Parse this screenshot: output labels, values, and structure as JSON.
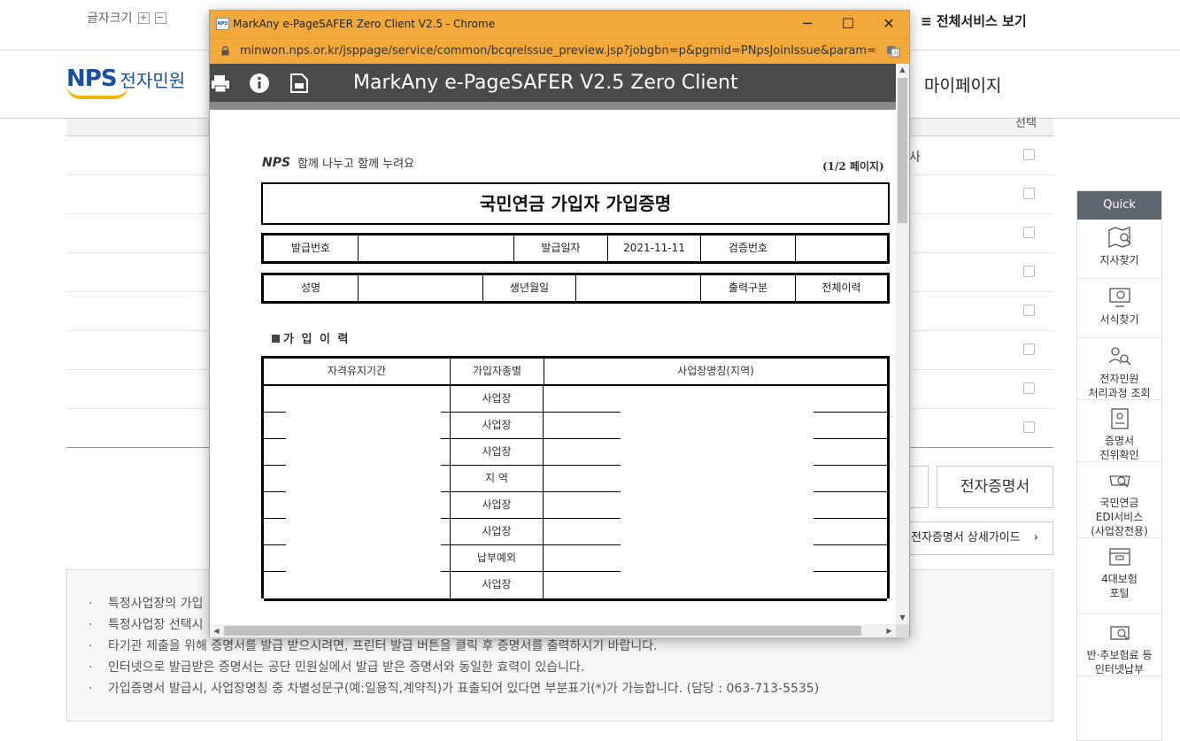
{
  "site": {
    "font_size_label": "글자크기",
    "font_plus": "+",
    "font_minus": "−",
    "all_services": "≡ 전체서비스 보기",
    "logo_text": "NPS",
    "logo_sub": "전자민원",
    "mypage": "마이페이지",
    "ecert_button": "전자증명서",
    "ecert_guide": "전자증명서 상세가이드",
    "guide_arrow": "›",
    "notes": [
      "특정사업장의 가입",
      "특정사업장 선택시",
      "타기관 제출을 위해 증명서를 발급 받으시려면, 프린터 발급 버튼을 클릭 후 증명서를 출력하시기 바랍니다.",
      "인터넷으로 발급받은 증명서는 공단 민원실에서 발급 받은 증명서와 동일한 효력이 있습니다.",
      "가입증명서 발급시, 사업장명칭 중 차별성문구(예:일용직,계약직)가 표출되어 있다면 부분표기(*)가 가능합니다. (담당 : 063-713-5535)"
    ],
    "bg_row_fragment": "사",
    "bg_header_fragment": "선택"
  },
  "quick": {
    "title": "Quick",
    "items": [
      {
        "label": "지사찾기",
        "icon": "map-search-icon"
      },
      {
        "label": "서식찾기",
        "icon": "monitor-search-icon"
      },
      {
        "label": "전자민원\n처리과정 조회",
        "icon": "people-search-icon"
      },
      {
        "label": "증명서\n진위확인",
        "icon": "id-card-icon"
      },
      {
        "label": "국민연금\nEDI서비스\n(사업장전용)",
        "icon": "fax-search-icon"
      },
      {
        "label": "4대보험\n포털",
        "icon": "folder-icon"
      },
      {
        "label": "반·추보험료 등\n인터넷납부",
        "icon": "card-payment-icon"
      }
    ]
  },
  "popup": {
    "window_title": "MarkAny e-PageSAFER Zero Client V2.5 - Chrome",
    "favicon_text": "NPS",
    "minimize": "─",
    "maximize": "☐",
    "close": "✕",
    "url": "minwon.nps.or.kr/jsppage/service/common/bcqrelssue_preview.jsp?jobgbn=p&pgmid=PNpsJoinIssue&param=i...",
    "viewer_title": "MarkAny e-PageSAFER V2.5 Zero Client",
    "toolbar_icons": [
      "print-icon",
      "info-icon",
      "save-icon"
    ]
  },
  "document": {
    "logo": "NPS",
    "slogan": "함께 나누고 함께 누려요",
    "page_indicator": "(1/2 페이지)",
    "title": "국민연금 가입자 가입증명",
    "row1": {
      "issue_no_label": "발급번호",
      "issue_no_value": "",
      "issue_date_label": "발급일자",
      "issue_date_value": "2021-11-11",
      "verify_label": "검증번호",
      "verify_value": ""
    },
    "row2": {
      "name_label": "성명",
      "name_value": "",
      "birth_label": "생년월일",
      "birth_value": "",
      "output_label": "출력구분",
      "output_value": "전체이력"
    },
    "section_title": "가 입 이 력",
    "history_headers": [
      "자격유지기간",
      "가입자종별",
      "사업장명칭(지역)"
    ],
    "history_rows": [
      {
        "period": "",
        "type": "사업장",
        "workplace": ""
      },
      {
        "period": "",
        "type": "사업장",
        "workplace": ""
      },
      {
        "period": "",
        "type": "사업장",
        "workplace": ""
      },
      {
        "period": "",
        "type": "지 역",
        "workplace": ""
      },
      {
        "period": "",
        "type": "사업장",
        "workplace": ""
      },
      {
        "period": "",
        "type": "사업장",
        "workplace": ""
      },
      {
        "period": "",
        "type": "납부예외",
        "workplace": ""
      },
      {
        "period": "",
        "type": "사업장",
        "workplace": ""
      }
    ]
  }
}
